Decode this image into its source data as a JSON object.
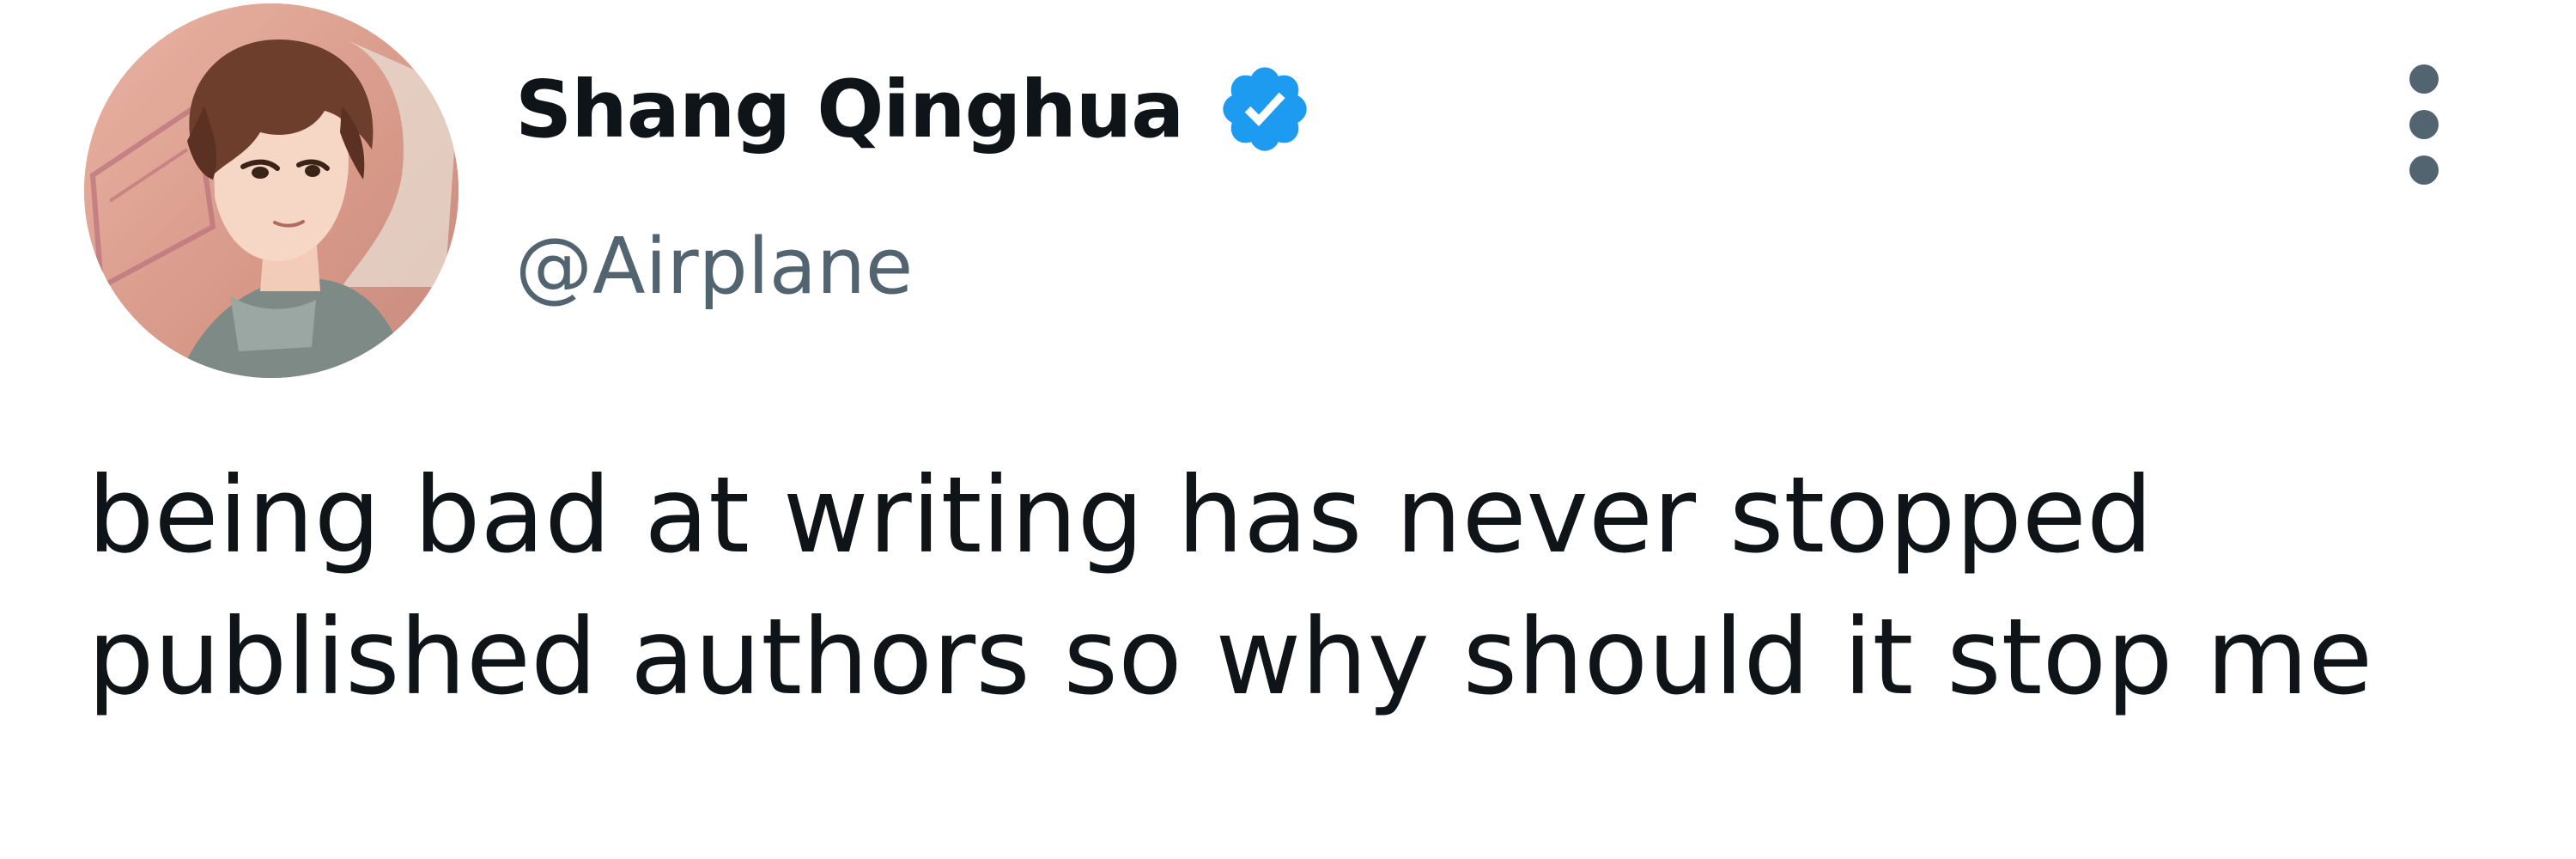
{
  "tweet": {
    "author": {
      "display_name": "Shang Qinghua",
      "handle": "@Airplane",
      "verified": true,
      "avatar": "avatar-portrait"
    },
    "text": "being bad at writing has never stopped published authors so why should it stop me",
    "icons": {
      "verified": "verified-badge-icon",
      "more": "more-options-icon"
    },
    "colors": {
      "verified_blue": "#1d9bf0",
      "handle_gray": "#536471",
      "text": "#0f1419",
      "icon_gray": "#536471"
    }
  }
}
